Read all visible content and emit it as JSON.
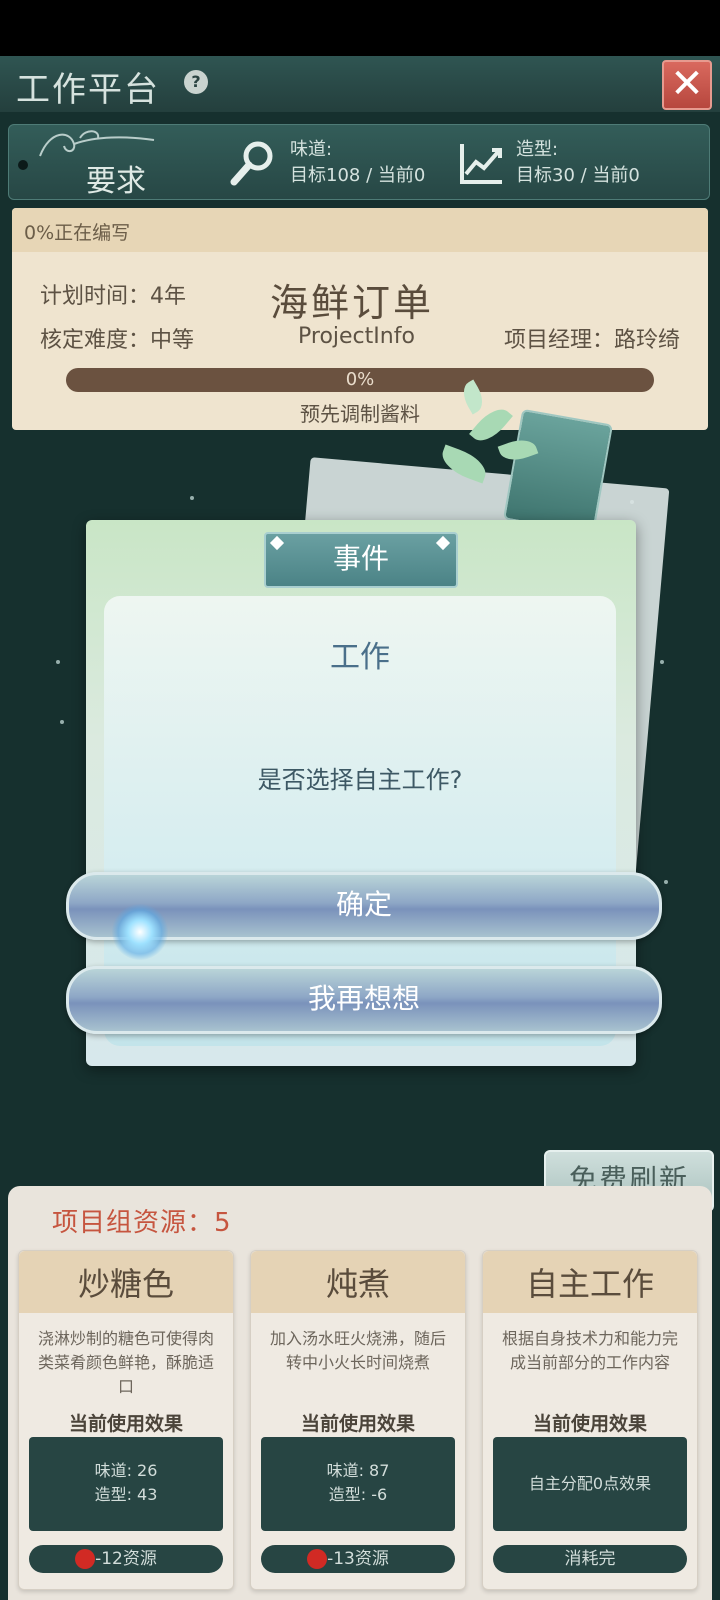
{
  "header": {
    "title": "工作平台",
    "help": "?",
    "close": "✕"
  },
  "requirements": {
    "label": "要求",
    "taste": {
      "label": "味道:",
      "value": "目标108 / 当前0"
    },
    "shape": {
      "label": "造型:",
      "value": "目标30 / 当前0"
    }
  },
  "project": {
    "status": "0%正在编写",
    "plan_time": "计划时间：4年",
    "difficulty": "核定难度：中等",
    "title": "海鲜订单",
    "subtitle": "ProjectInfo",
    "manager": "项目经理：路玲绮",
    "progress": 0,
    "progress_label": "0%",
    "step": "预先调制酱料"
  },
  "dialog": {
    "tab": "事件",
    "heading": "工作",
    "question": "是否选择自主工作?",
    "confirm": "确定",
    "cancel": "我再想想"
  },
  "bottom": {
    "refresh": "免费刷新",
    "resources": "项目组资源：5",
    "cards": [
      {
        "title": "炒糖色",
        "desc": "浇淋炒制的糖色可使得肉类菜肴颜色鲜艳，酥脆适口",
        "effect_title": "当前使用效果",
        "effect_1": "味道: 26",
        "effect_2": "造型: 43",
        "cost": "-12资源"
      },
      {
        "title": "炖煮",
        "desc": "加入汤水旺火烧沸，随后转中小火长时间烧煮",
        "effect_title": "当前使用效果",
        "effect_1": "味道: 87",
        "effect_2": "造型: -6",
        "cost": "-13资源"
      },
      {
        "title": "自主工作",
        "desc": "根据自身技术力和能力完成当前部分的工作内容",
        "effect_title": "当前使用效果",
        "effect_1": "自主分配0点效果",
        "cost": "消耗完"
      }
    ]
  },
  "colors": {
    "accent_red": "#d12a24",
    "panel_dark": "#274543",
    "resource_red": "#c6553f"
  },
  "icons": [
    "help-icon",
    "close-icon",
    "magnifier-icon",
    "trend-chart-icon",
    "resource-dot-icon"
  ]
}
